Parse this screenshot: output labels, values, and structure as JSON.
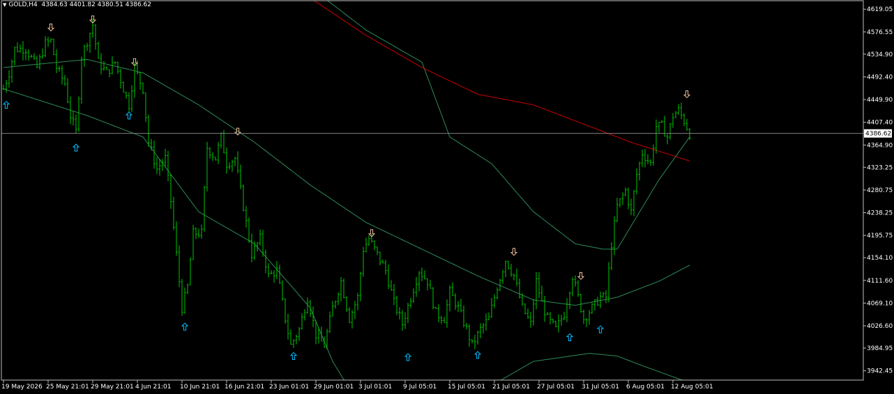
{
  "header": {
    "symbol_tf": "GOLD,H4",
    "open": "4384.63",
    "high": "4401.82",
    "low": "4380.51",
    "close": "4386.62"
  },
  "colors": {
    "background": "#000000",
    "candle": "#00c800",
    "axis": "#c0c0c0",
    "text": "#ffffff",
    "band": "#2e8b57",
    "ma_red": "#c80000",
    "price_line": "#808080",
    "arrow_up": "#00bfff",
    "arrow_down": "#f0c0a0",
    "price_label_bg": "#ffffff",
    "price_label_fg": "#000000"
  },
  "chart_data": {
    "type": "ohlc",
    "symbol": "GOLD",
    "timeframe": "H4",
    "ylim": [
      3925,
      4635
    ],
    "y_ticks": [
      "4619.05",
      "4576.55",
      "4534.90",
      "4492.40",
      "4449.90",
      "4407.40",
      "4364.90",
      "4323.25",
      "4280.75",
      "4238.25",
      "4195.75",
      "4154.10",
      "4111.60",
      "4069.10",
      "4026.60",
      "3984.95",
      "3942.45"
    ],
    "x_ticks": [
      {
        "label": "19 May 2026",
        "bar": 0
      },
      {
        "label": "25 May 21:01",
        "bar": 16
      },
      {
        "label": "29 May 21:01",
        "bar": 32
      },
      {
        "label": "4 Jun 21:01",
        "bar": 48
      },
      {
        "label": "10 Jun 21:01",
        "bar": 64
      },
      {
        "label": "16 Jun 21:01",
        "bar": 80
      },
      {
        "label": "23 Jun 01:01",
        "bar": 96
      },
      {
        "label": "29 Jun 01:01",
        "bar": 112
      },
      {
        "label": "3 Jul 01:01",
        "bar": 128
      },
      {
        "label": "9 Jul 05:01",
        "bar": 144
      },
      {
        "label": "15 Jul 05:01",
        "bar": 160
      },
      {
        "label": "21 Jul 05:01",
        "bar": 176
      },
      {
        "label": "27 Jul 05:01",
        "bar": 192
      },
      {
        "label": "31 Jul 05:01",
        "bar": 208
      },
      {
        "label": "6 Aug 05:01",
        "bar": 224
      },
      {
        "label": "12 Aug 05:01",
        "bar": 240
      }
    ],
    "bar_count": 247,
    "close_anchors": [
      [
        0,
        4470
      ],
      [
        2,
        4500
      ],
      [
        4,
        4545
      ],
      [
        8,
        4545
      ],
      [
        12,
        4510
      ],
      [
        15,
        4555
      ],
      [
        17,
        4560
      ],
      [
        19,
        4510
      ],
      [
        22,
        4480
      ],
      [
        24,
        4420
      ],
      [
        26,
        4390
      ],
      [
        28,
        4530
      ],
      [
        30,
        4560
      ],
      [
        32,
        4590
      ],
      [
        34,
        4520
      ],
      [
        37,
        4500
      ],
      [
        40,
        4520
      ],
      [
        43,
        4470
      ],
      [
        45,
        4440
      ],
      [
        47,
        4510
      ],
      [
        50,
        4470
      ],
      [
        52,
        4370
      ],
      [
        55,
        4320
      ],
      [
        58,
        4340
      ],
      [
        60,
        4260
      ],
      [
        62,
        4160
      ],
      [
        64,
        4060
      ],
      [
        66,
        4100
      ],
      [
        68,
        4200
      ],
      [
        71,
        4200
      ],
      [
        73,
        4360
      ],
      [
        76,
        4340
      ],
      [
        78,
        4380
      ],
      [
        80,
        4330
      ],
      [
        83,
        4340
      ],
      [
        86,
        4250
      ],
      [
        89,
        4160
      ],
      [
        92,
        4190
      ],
      [
        95,
        4120
      ],
      [
        98,
        4130
      ],
      [
        101,
        4040
      ],
      [
        103,
        3990
      ],
      [
        106,
        4020
      ],
      [
        109,
        4080
      ],
      [
        112,
        4010
      ],
      [
        115,
        3990
      ],
      [
        118,
        4060
      ],
      [
        121,
        4110
      ],
      [
        124,
        4040
      ],
      [
        127,
        4080
      ],
      [
        129,
        4170
      ],
      [
        131,
        4190
      ],
      [
        134,
        4160
      ],
      [
        137,
        4130
      ],
      [
        140,
        4070
      ],
      [
        143,
        4030
      ],
      [
        146,
        4080
      ],
      [
        149,
        4130
      ],
      [
        152,
        4110
      ],
      [
        155,
        4050
      ],
      [
        158,
        4040
      ],
      [
        160,
        4090
      ],
      [
        163,
        4060
      ],
      [
        166,
        4020
      ],
      [
        168,
        3990
      ],
      [
        171,
        4020
      ],
      [
        174,
        4040
      ],
      [
        177,
        4100
      ],
      [
        180,
        4150
      ],
      [
        183,
        4120
      ],
      [
        186,
        4060
      ],
      [
        189,
        4030
      ],
      [
        191,
        4110
      ],
      [
        193,
        4070
      ],
      [
        195,
        4040
      ],
      [
        198,
        4020
      ],
      [
        201,
        4050
      ],
      [
        204,
        4120
      ],
      [
        206,
        4080
      ],
      [
        208,
        4040
      ],
      [
        211,
        4060
      ],
      [
        214,
        4080
      ],
      [
        216,
        4080
      ],
      [
        218,
        4180
      ],
      [
        220,
        4250
      ],
      [
        223,
        4280
      ],
      [
        225,
        4240
      ],
      [
        227,
        4310
      ],
      [
        229,
        4350
      ],
      [
        232,
        4330
      ],
      [
        234,
        4400
      ],
      [
        236,
        4400
      ],
      [
        238,
        4380
      ],
      [
        240,
        4420
      ],
      [
        242,
        4430
      ],
      [
        244,
        4410
      ],
      [
        246,
        4386.62
      ]
    ],
    "series": [
      {
        "role": "band-upper",
        "color": "#2e8b57",
        "points": [
          [
            60,
            4800
          ],
          [
            100,
            4700
          ],
          [
            130,
            4580
          ],
          [
            150,
            4520
          ],
          [
            160,
            4380
          ],
          [
            175,
            4330
          ],
          [
            190,
            4240
          ],
          [
            205,
            4180
          ],
          [
            215,
            4170
          ],
          [
            220,
            4170
          ],
          [
            235,
            4300
          ],
          [
            246,
            4380
          ]
        ]
      },
      {
        "role": "band-middle",
        "color": "#2e8b57",
        "points": [
          [
            0,
            4510
          ],
          [
            30,
            4525
          ],
          [
            50,
            4500
          ],
          [
            70,
            4440
          ],
          [
            90,
            4370
          ],
          [
            110,
            4290
          ],
          [
            130,
            4220
          ],
          [
            150,
            4170
          ],
          [
            170,
            4120
          ],
          [
            190,
            4075
          ],
          [
            205,
            4065
          ],
          [
            220,
            4080
          ],
          [
            235,
            4110
          ],
          [
            246,
            4140
          ]
        ]
      },
      {
        "role": "band-lower",
        "color": "#2e8b57",
        "points": [
          [
            0,
            4470
          ],
          [
            30,
            4420
          ],
          [
            50,
            4380
          ],
          [
            70,
            4240
          ],
          [
            90,
            4180
          ],
          [
            100,
            4120
          ],
          [
            110,
            4060
          ],
          [
            118,
            3960
          ],
          [
            125,
            3900
          ],
          [
            150,
            3880
          ],
          [
            170,
            3900
          ],
          [
            190,
            3960
          ],
          [
            210,
            3975
          ],
          [
            220,
            3970
          ],
          [
            230,
            3950
          ],
          [
            246,
            3920
          ]
        ]
      },
      {
        "role": "ma-red",
        "color": "#c80000",
        "points": [
          [
            110,
            4640
          ],
          [
            130,
            4570
          ],
          [
            150,
            4510
          ],
          [
            170,
            4460
          ],
          [
            190,
            4440
          ],
          [
            200,
            4420
          ],
          [
            210,
            4400
          ],
          [
            225,
            4370
          ],
          [
            246,
            4335
          ]
        ]
      }
    ],
    "arrows": [
      {
        "bar": 1,
        "dir": "up",
        "price": 4440
      },
      {
        "bar": 17,
        "dir": "down",
        "price": 4585
      },
      {
        "bar": 26,
        "dir": "up",
        "price": 4360
      },
      {
        "bar": 32,
        "dir": "down",
        "price": 4600
      },
      {
        "bar": 45,
        "dir": "up",
        "price": 4420
      },
      {
        "bar": 47,
        "dir": "down",
        "price": 4520
      },
      {
        "bar": 65,
        "dir": "up",
        "price": 4025
      },
      {
        "bar": 84,
        "dir": "down",
        "price": 4390
      },
      {
        "bar": 104,
        "dir": "up",
        "price": 3970
      },
      {
        "bar": 132,
        "dir": "down",
        "price": 4200
      },
      {
        "bar": 145,
        "dir": "up",
        "price": 3968
      },
      {
        "bar": 170,
        "dir": "up",
        "price": 3972
      },
      {
        "bar": 183,
        "dir": "down",
        "price": 4165
      },
      {
        "bar": 203,
        "dir": "up",
        "price": 4005
      },
      {
        "bar": 207,
        "dir": "down",
        "price": 4120
      },
      {
        "bar": 214,
        "dir": "up",
        "price": 4020
      },
      {
        "bar": 245,
        "dir": "down",
        "price": 4460
      }
    ],
    "current_price": 4386.62,
    "current_price_label": "4386.62"
  }
}
